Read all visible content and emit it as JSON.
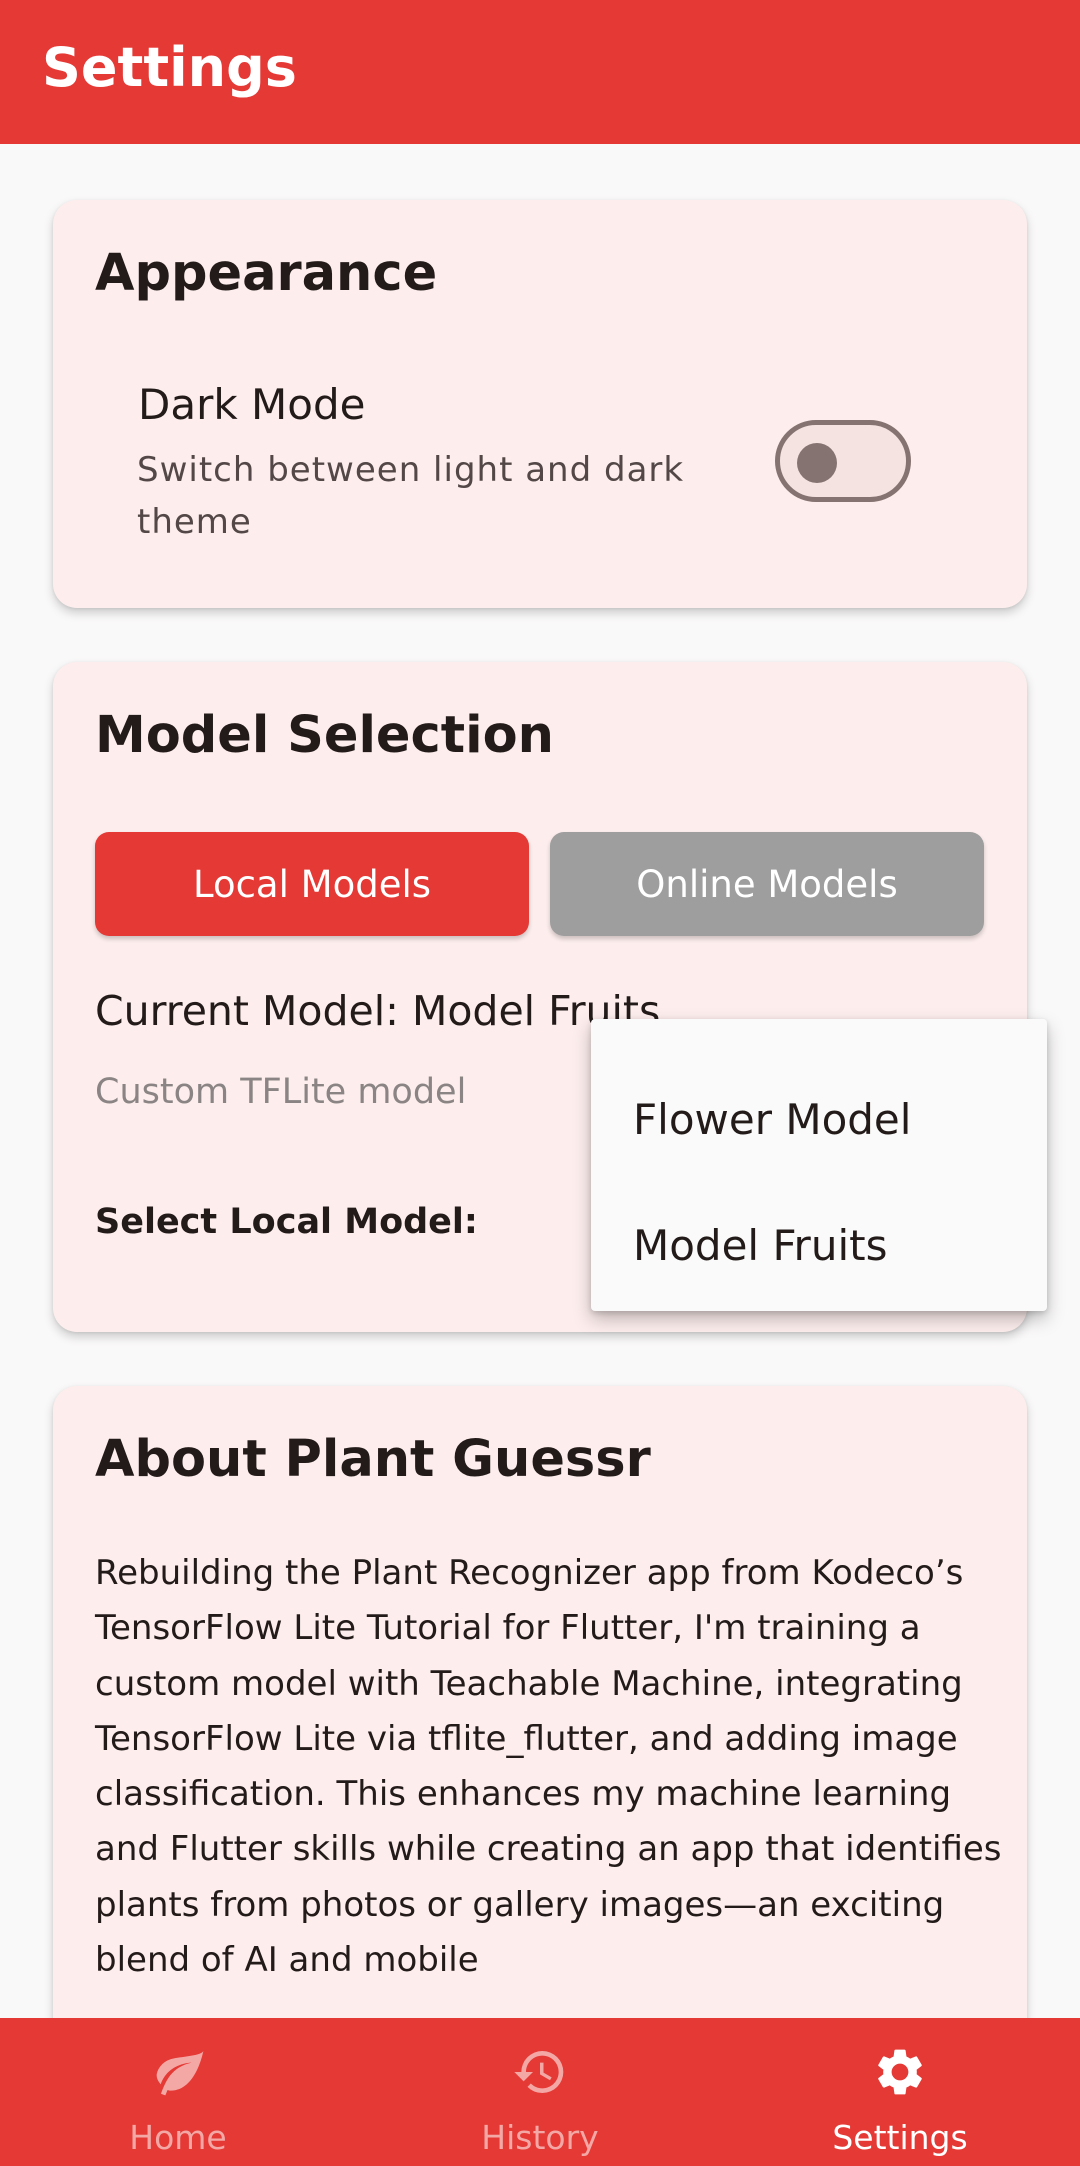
{
  "app_bar": {
    "title": "Settings"
  },
  "appearance": {
    "title": "Appearance",
    "dark_mode": {
      "title": "Dark Mode",
      "subtitle": "Switch between light and dark theme",
      "enabled": false
    }
  },
  "model_selection": {
    "title": "Model Selection",
    "tabs": {
      "local": "Local Models",
      "online": "Online Models"
    },
    "active_tab": "local",
    "current_model": "Current Model: Model Fruits",
    "model_description": "Custom TFLite model",
    "select_label": "Select Local Model:",
    "dropdown_options": [
      "Flower Model",
      "Model Fruits"
    ]
  },
  "about": {
    "title": "About Plant Guessr",
    "body": "Rebuilding the Plant Recognizer app from Kodeco’s TensorFlow Lite Tutorial for Flutter, I'm training a custom model with Teachable Machine, integrating TensorFlow Lite via tflite_flutter, and adding image classification. This enhances my machine learning and Flutter skills while creating an app that identifies plants from photos or gallery images—an exciting blend of AI and mobile"
  },
  "bottom_nav": {
    "items": [
      {
        "label": "Home",
        "icon": "leaf-icon"
      },
      {
        "label": "History",
        "icon": "history-icon"
      },
      {
        "label": "Settings",
        "icon": "gear-icon"
      }
    ],
    "active": "Settings"
  },
  "colors": {
    "primary": "#e53935",
    "card_background": "#fdeeed",
    "inactive_button": "#9e9e9e"
  }
}
